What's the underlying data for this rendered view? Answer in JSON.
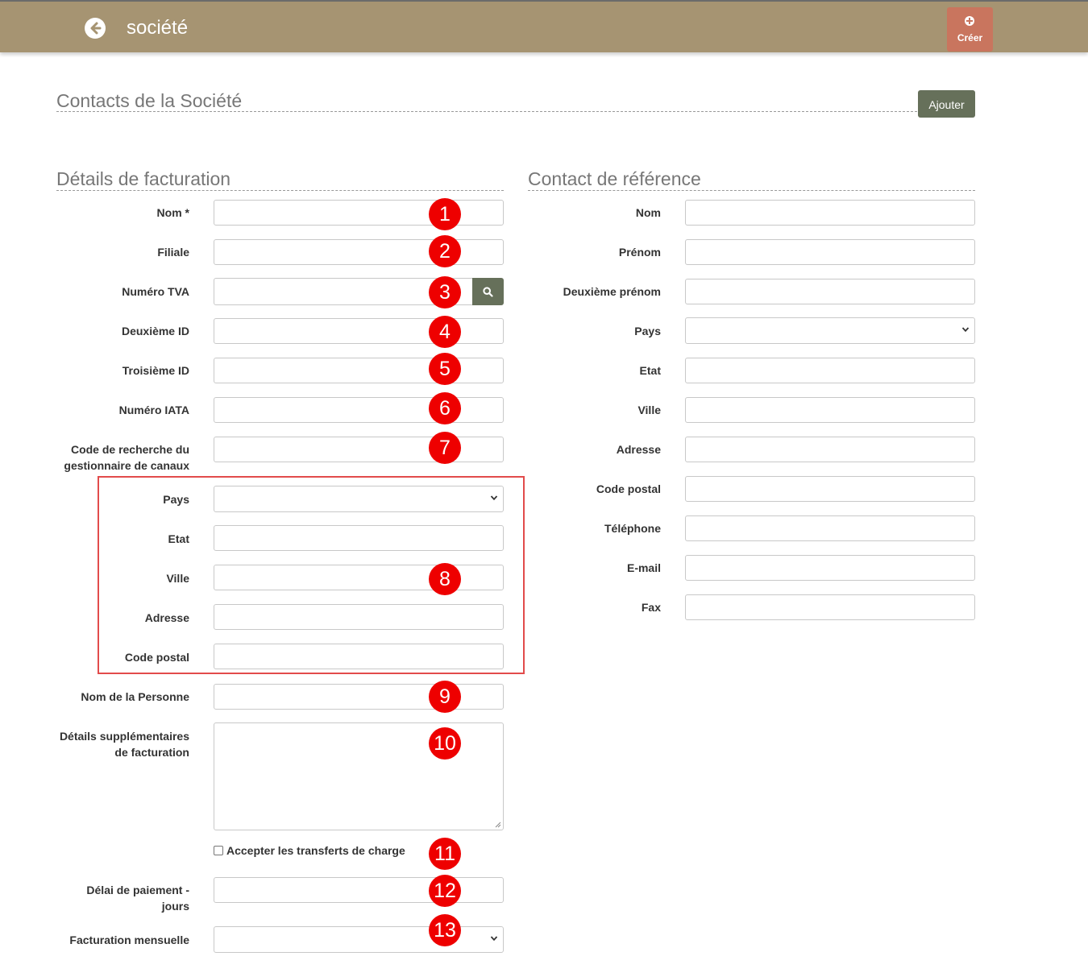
{
  "header": {
    "title": "société",
    "create_label": "Créer"
  },
  "contacts": {
    "title": "Contacts de la Société",
    "add_label": "Ajouter"
  },
  "billing": {
    "title": "Détails de facturation",
    "nom_label": "Nom *",
    "filiale_label": "Filiale",
    "tva_label": "Numéro TVA",
    "deuxieme_id_label": "Deuxième ID",
    "troisieme_id_label": "Troisième ID",
    "iata_label": "Numéro IATA",
    "code_recherche_line1": "Code de recherche du",
    "code_recherche_line2": "gestionnaire de canaux",
    "pays_label": "Pays",
    "etat_label": "Etat",
    "ville_label": "Ville",
    "adresse_label": "Adresse",
    "code_postal_label": "Code postal",
    "personne_label": "Nom de la Personne",
    "details_line1": "Détails supplémentaires",
    "details_line2": "de facturation",
    "accept_label": "Accepter les transferts de charge",
    "delai_line1": "Délai de paiement -",
    "delai_line2": "jours",
    "mensuelle_label": "Facturation mensuelle"
  },
  "reference": {
    "title": "Contact de référence",
    "nom_label": "Nom",
    "prenom_label": "Prénom",
    "deuxieme_prenom_label": "Deuxième prénom",
    "pays_label": "Pays",
    "etat_label": "Etat",
    "ville_label": "Ville",
    "adresse_label": "Adresse",
    "code_postal_label": "Code postal",
    "telephone_label": "Téléphone",
    "email_label": "E-mail",
    "fax_label": "Fax"
  },
  "badges": [
    "1",
    "2",
    "3",
    "4",
    "5",
    "6",
    "7",
    "8",
    "9",
    "10",
    "11",
    "12",
    "13"
  ],
  "colors": {
    "header": "#a69472",
    "create_button": "#c9755e",
    "action_button": "#66705a",
    "annotation": "#ee0000"
  }
}
